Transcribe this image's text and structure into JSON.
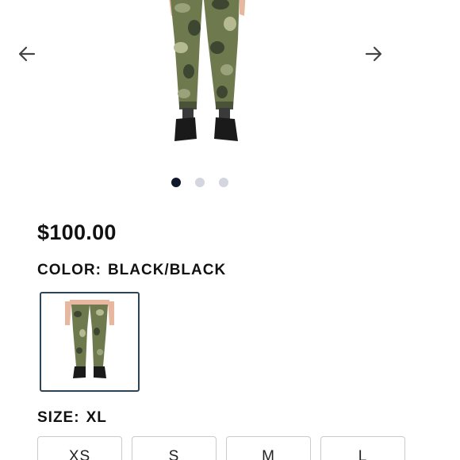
{
  "carousel": {
    "prev_icon": "arrow-left-icon",
    "next_icon": "arrow-right-icon",
    "image_subject": "camo-jogger-pants",
    "slide_count": 3,
    "active_slide": 1
  },
  "product": {
    "price": "$100.00"
  },
  "color": {
    "label": "COLOR:",
    "value": "BLACK/BLACK"
  },
  "size": {
    "label": "SIZE:",
    "value": "XL",
    "options": [
      "XS",
      "S",
      "M",
      "L"
    ]
  },
  "colors": {
    "camo_light": "#9aa27a",
    "camo_mid": "#6e7a4e",
    "camo_dark": "#3d4630",
    "dot_active": "#10182b",
    "dot_inactive": "#d3d6de",
    "swatch_border": "#2d4457"
  }
}
